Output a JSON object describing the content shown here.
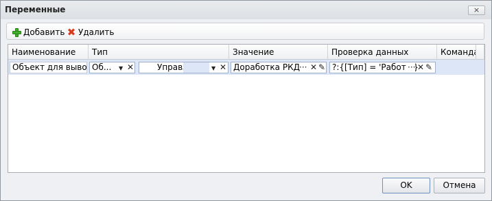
{
  "window": {
    "title": "Переменные",
    "close_glyph": "×"
  },
  "toolbar": {
    "add_label": "Добавить",
    "delete_label": "Удалить"
  },
  "grid": {
    "columns": [
      "Наименование",
      "Тип",
      "Значение",
      "Проверка данных",
      "Команда"
    ],
    "row": {
      "name": "Объект для вывода",
      "type": "Об...",
      "subtype": "Управл",
      "value": "Доработка РКД",
      "validation": "?:{[Тип] = 'Работа'}",
      "command": ""
    },
    "glyphs": {
      "dropdown": "▼",
      "clear": "✕",
      "more": "···",
      "edit": "✎"
    }
  },
  "buttons": {
    "ok": "OK",
    "cancel": "Отмена"
  }
}
